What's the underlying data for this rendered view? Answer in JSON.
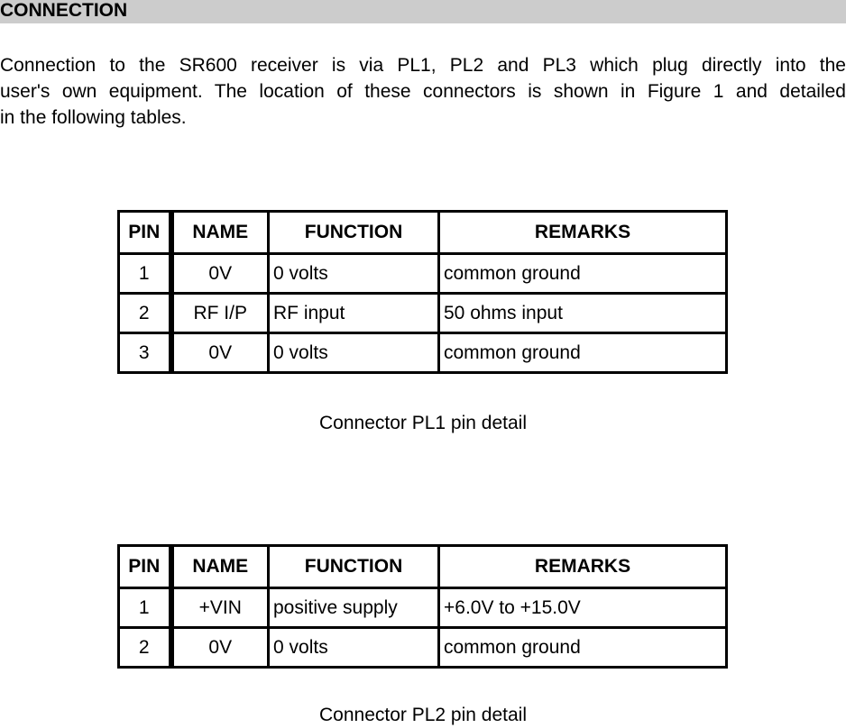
{
  "section": {
    "title": "CONNECTION"
  },
  "intro": {
    "lines": [
      "Connection to the SR600 receiver is via PL1, PL2 and PL3 which plug directly into the",
      "user's own equipment.  The location of these connectors is shown in Figure 1 and detailed",
      "in the following tables."
    ]
  },
  "tables": [
    {
      "headers": [
        "PIN",
        "NAME",
        "FUNCTION",
        "REMARKS"
      ],
      "rows": [
        {
          "pin": "1",
          "name": "0V",
          "function": "0 volts",
          "remarks": "common ground"
        },
        {
          "pin": "2",
          "name": "RF I/P",
          "function": "RF input",
          "remarks": "50 ohms input"
        },
        {
          "pin": "3",
          "name": "0V",
          "function": "0 volts",
          "remarks": "common ground"
        }
      ],
      "caption": "Connector PL1 pin detail"
    },
    {
      "headers": [
        "PIN",
        "NAME",
        "FUNCTION",
        "REMARKS"
      ],
      "rows": [
        {
          "pin": "1",
          "name": "+VIN",
          "function": "positive supply",
          "remarks": "+6.0V to +15.0V"
        },
        {
          "pin": "2",
          "name": "0V",
          "function": "0 volts",
          "remarks": "common ground"
        }
      ],
      "caption": "Connector PL2 pin detail"
    }
  ],
  "colors": {
    "header_band": "#cccccc",
    "text": "#000000",
    "background": "#ffffff"
  }
}
